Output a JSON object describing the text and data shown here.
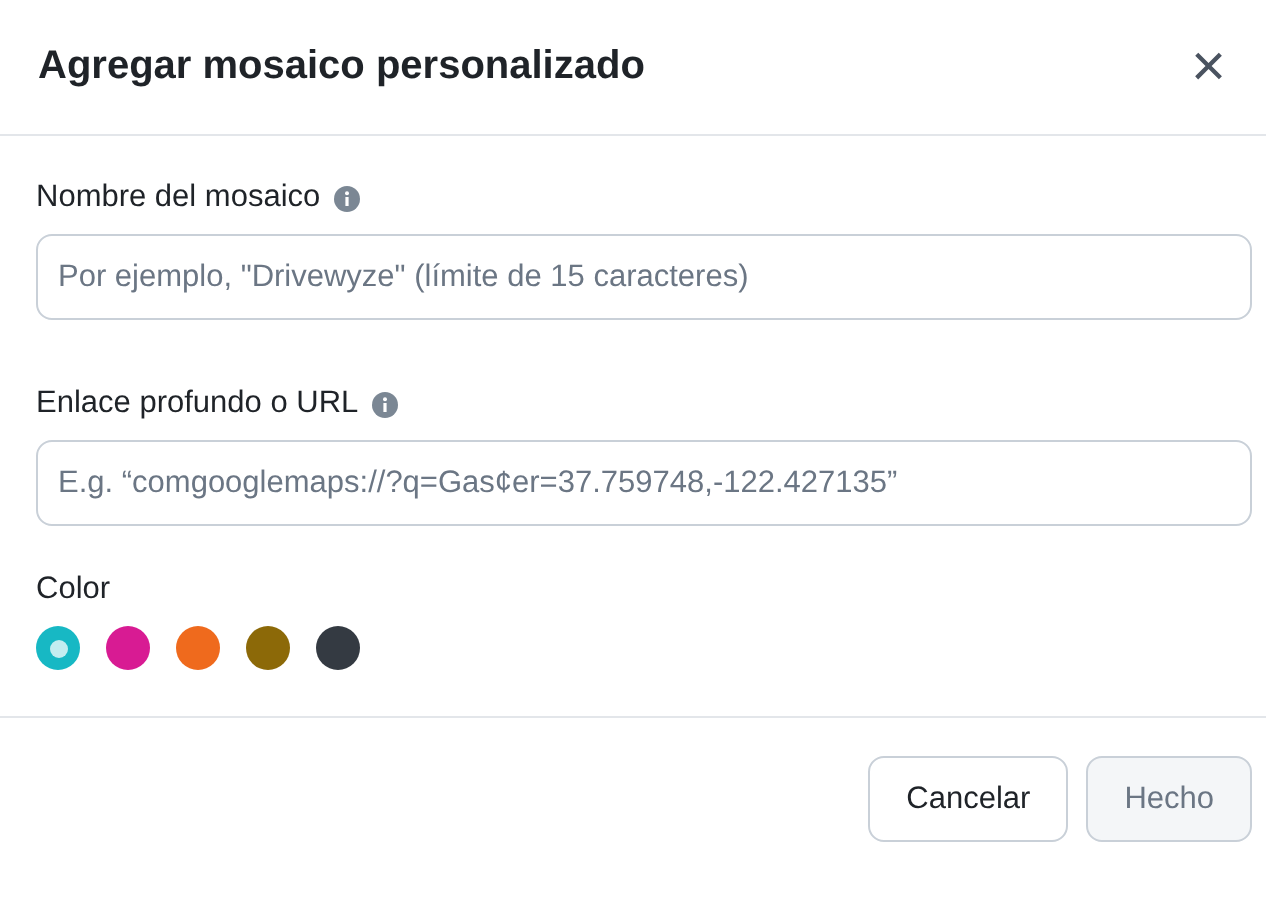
{
  "dialog": {
    "title": "Agregar mosaico personalizado",
    "close": "×"
  },
  "fields": [
    {
      "label": "Nombre del mosaico",
      "placeholder": "Por ejemplo, \"Drivewyze\" (límite de 15 caracteres)"
    },
    {
      "label": "Enlace profundo o URL",
      "placeholder": "E.g. “comgooglemaps://?q=Gas¢er=37.759748,-122.427135”"
    }
  ],
  "color": {
    "label": "Color",
    "swatches": [
      {
        "color": "#17b8c4",
        "selected": true
      },
      {
        "color": "#d81b93",
        "selected": false
      },
      {
        "color": "#ef6a1d",
        "selected": false
      },
      {
        "color": "#8c6908",
        "selected": false
      },
      {
        "color": "#343a42",
        "selected": false
      }
    ]
  },
  "buttons": [
    {
      "label": "Cancelar",
      "disabled": false
    },
    {
      "label": "Hecho",
      "disabled": true
    }
  ]
}
